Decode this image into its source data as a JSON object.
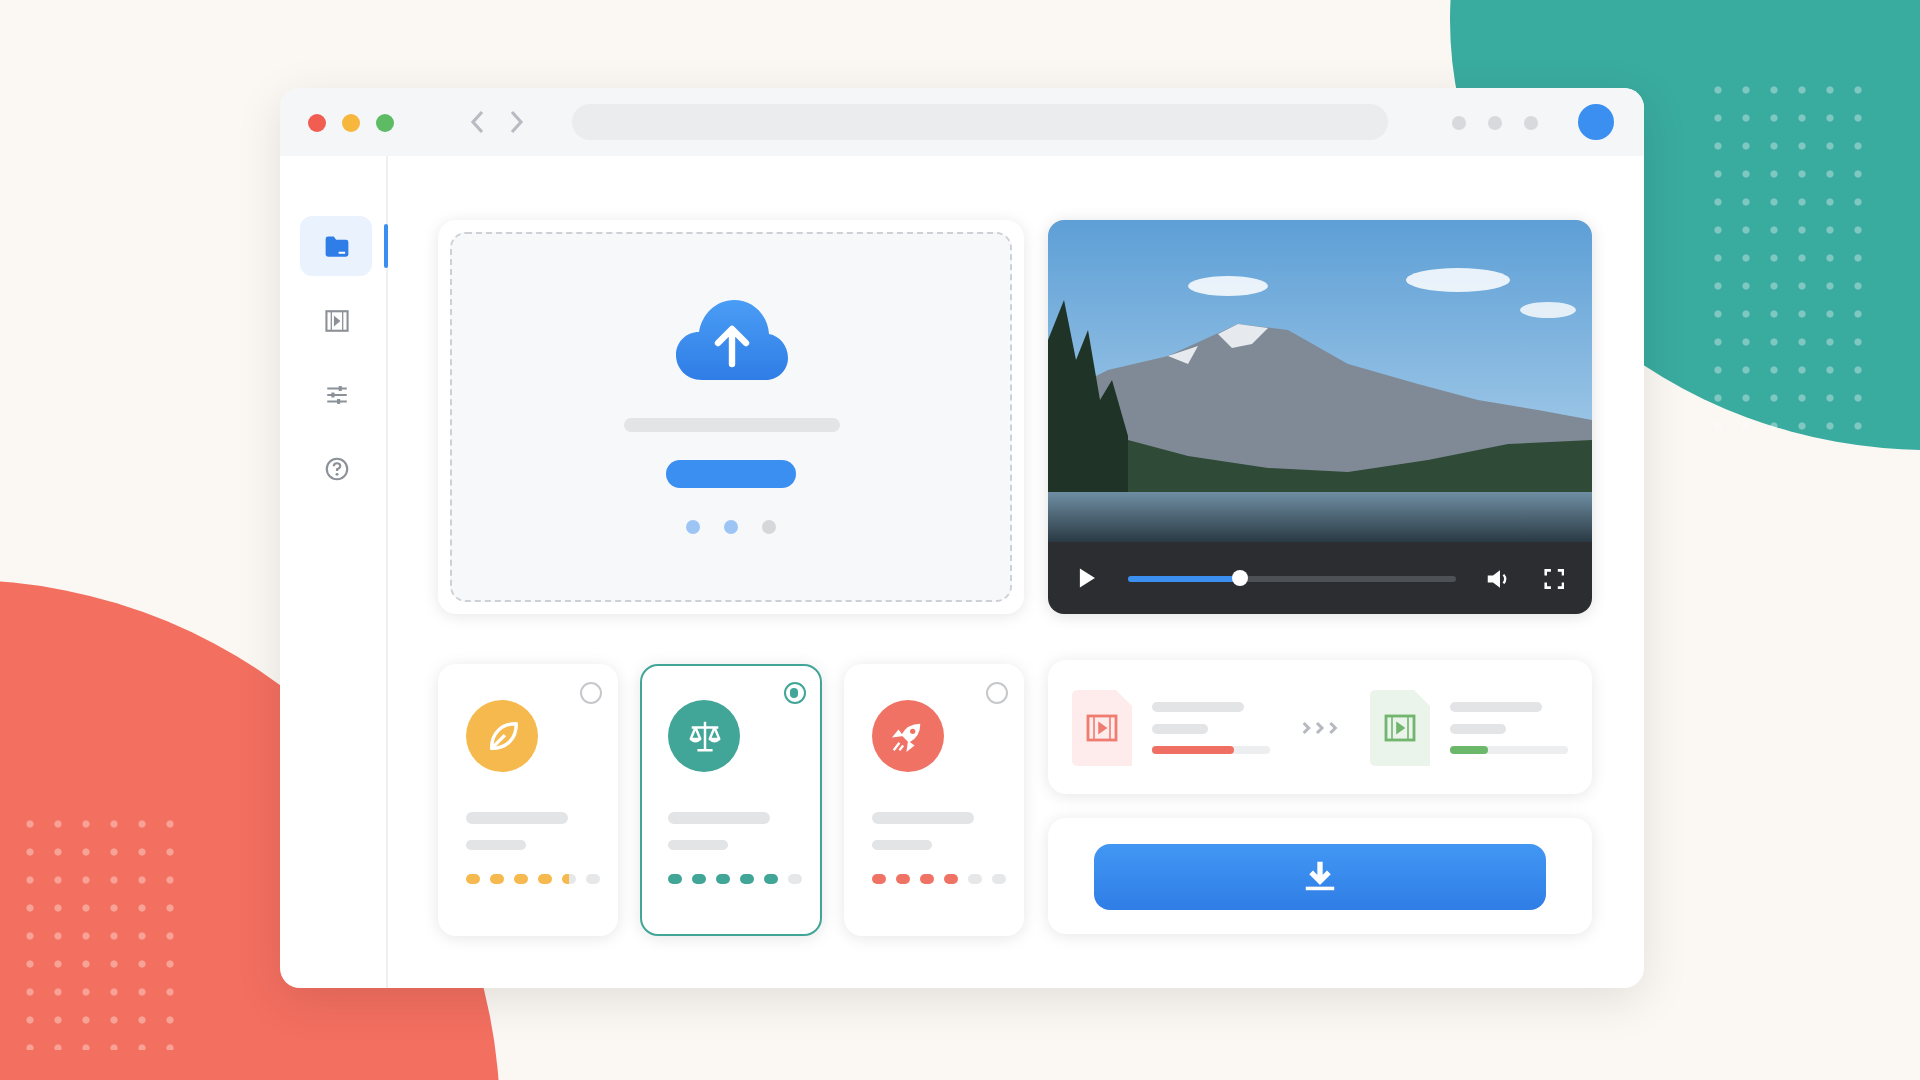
{
  "sidebar": {
    "items": [
      {
        "selected": true
      },
      {
        "selected": false
      },
      {
        "selected": false
      },
      {
        "selected": false
      }
    ]
  },
  "upload": {
    "step_dots": [
      {
        "active": true
      },
      {
        "active": true
      },
      {
        "active": false
      }
    ]
  },
  "video": {
    "progress": {
      "level": 0.34
    }
  },
  "presets": [
    {
      "selected": false,
      "color": "#f5b94e",
      "stars": 4.5
    },
    {
      "selected": true,
      "color": "#41a597",
      "stars": 5
    },
    {
      "selected": false,
      "color": "#f07264",
      "stars": 4
    }
  ],
  "conversion": {
    "source": {
      "level": 0.7
    },
    "target": {
      "level": 0.33
    }
  }
}
